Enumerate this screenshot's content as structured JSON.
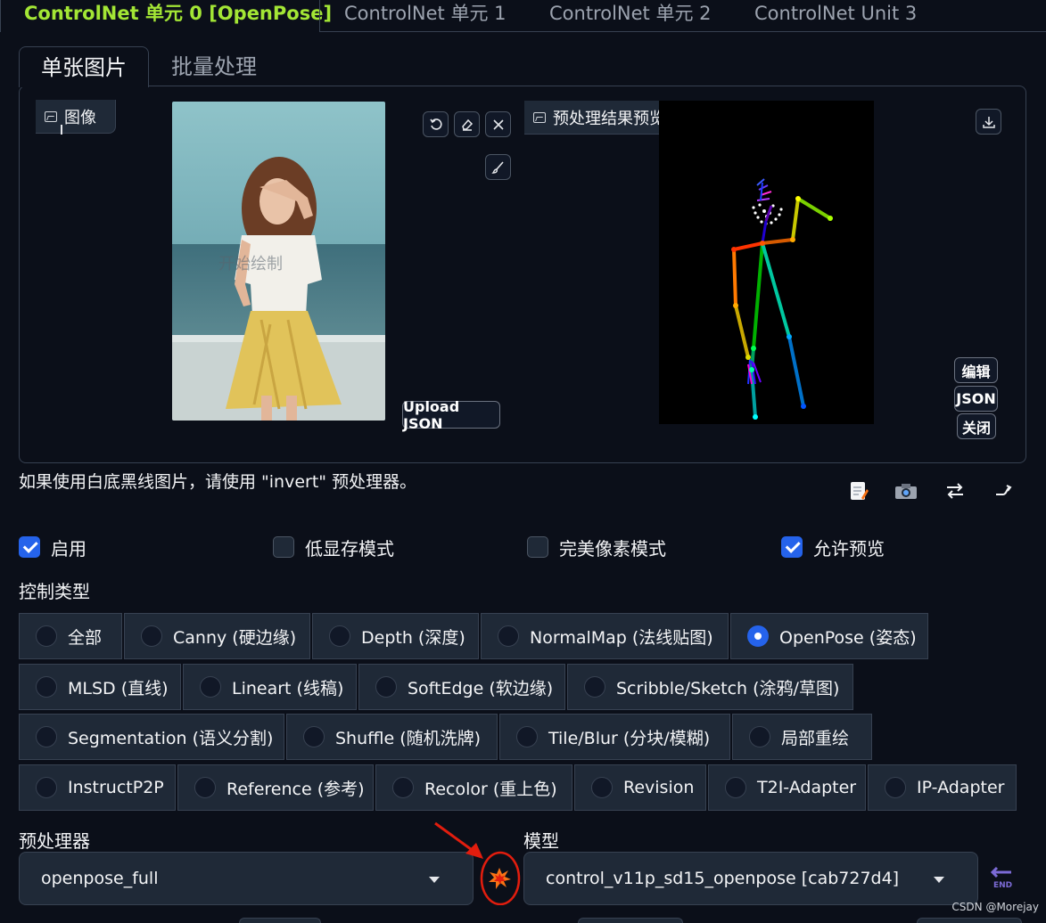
{
  "unit_tabs": [
    {
      "label": "ControlNet 单元 0 [OpenPose]",
      "active": true
    },
    {
      "label": "ControlNet 单元 1",
      "active": false
    },
    {
      "label": "ControlNet 单元 2",
      "active": false
    },
    {
      "label": "ControlNet Unit 3",
      "active": false
    }
  ],
  "image_tabs": [
    {
      "label": "单张图片",
      "active": true
    },
    {
      "label": "批量处理",
      "active": false
    }
  ],
  "image_panel": {
    "input_label": "图像",
    "photo_overlay_text": "开始绘制",
    "upload_json_label": "Upload JSON",
    "preview_label": "预处理结果预览",
    "edit_label": "编辑",
    "json_label": "JSON",
    "close_label": "关闭"
  },
  "hint_text": "如果使用白底黑线图片，请使用 \"invert\" 预处理器。",
  "checkboxes": [
    {
      "label": "启用",
      "checked": true
    },
    {
      "label": "低显存模式",
      "checked": false
    },
    {
      "label": "完美像素模式",
      "checked": false
    },
    {
      "label": "允许预览",
      "checked": true
    }
  ],
  "control_type_label": "控制类型",
  "control_types": [
    {
      "label": "全部",
      "selected": false
    },
    {
      "label": "Canny (硬边缘)",
      "selected": false
    },
    {
      "label": "Depth (深度)",
      "selected": false
    },
    {
      "label": "NormalMap (法线贴图)",
      "selected": false
    },
    {
      "label": "OpenPose (姿态)",
      "selected": true
    },
    {
      "label": "MLSD (直线)",
      "selected": false
    },
    {
      "label": "Lineart (线稿)",
      "selected": false
    },
    {
      "label": "SoftEdge (软边缘)",
      "selected": false
    },
    {
      "label": "Scribble/Sketch (涂鸦/草图)",
      "selected": false
    },
    {
      "label": "Segmentation (语义分割)",
      "selected": false
    },
    {
      "label": "Shuffle (随机洗牌)",
      "selected": false
    },
    {
      "label": "Tile/Blur (分块/模糊)",
      "selected": false
    },
    {
      "label": "局部重绘",
      "selected": false
    },
    {
      "label": "InstructP2P",
      "selected": false
    },
    {
      "label": "Reference (参考)",
      "selected": false
    },
    {
      "label": "Recolor (重上色)",
      "selected": false
    },
    {
      "label": "Revision",
      "selected": false
    },
    {
      "label": "T2I-Adapter",
      "selected": false
    },
    {
      "label": "IP-Adapter",
      "selected": false
    }
  ],
  "preprocessor": {
    "label": "预处理器",
    "value": "openpose_full"
  },
  "model": {
    "label": "模型",
    "value": "control_v11p_sd15_openpose [cab727d4]"
  },
  "send_icon_label": "END",
  "watermark": "CSDN @Morejay",
  "colors": {
    "accent_green": "#a3e635",
    "checkbox_blue": "#2563eb",
    "annotation_red": "#e11d0e"
  }
}
